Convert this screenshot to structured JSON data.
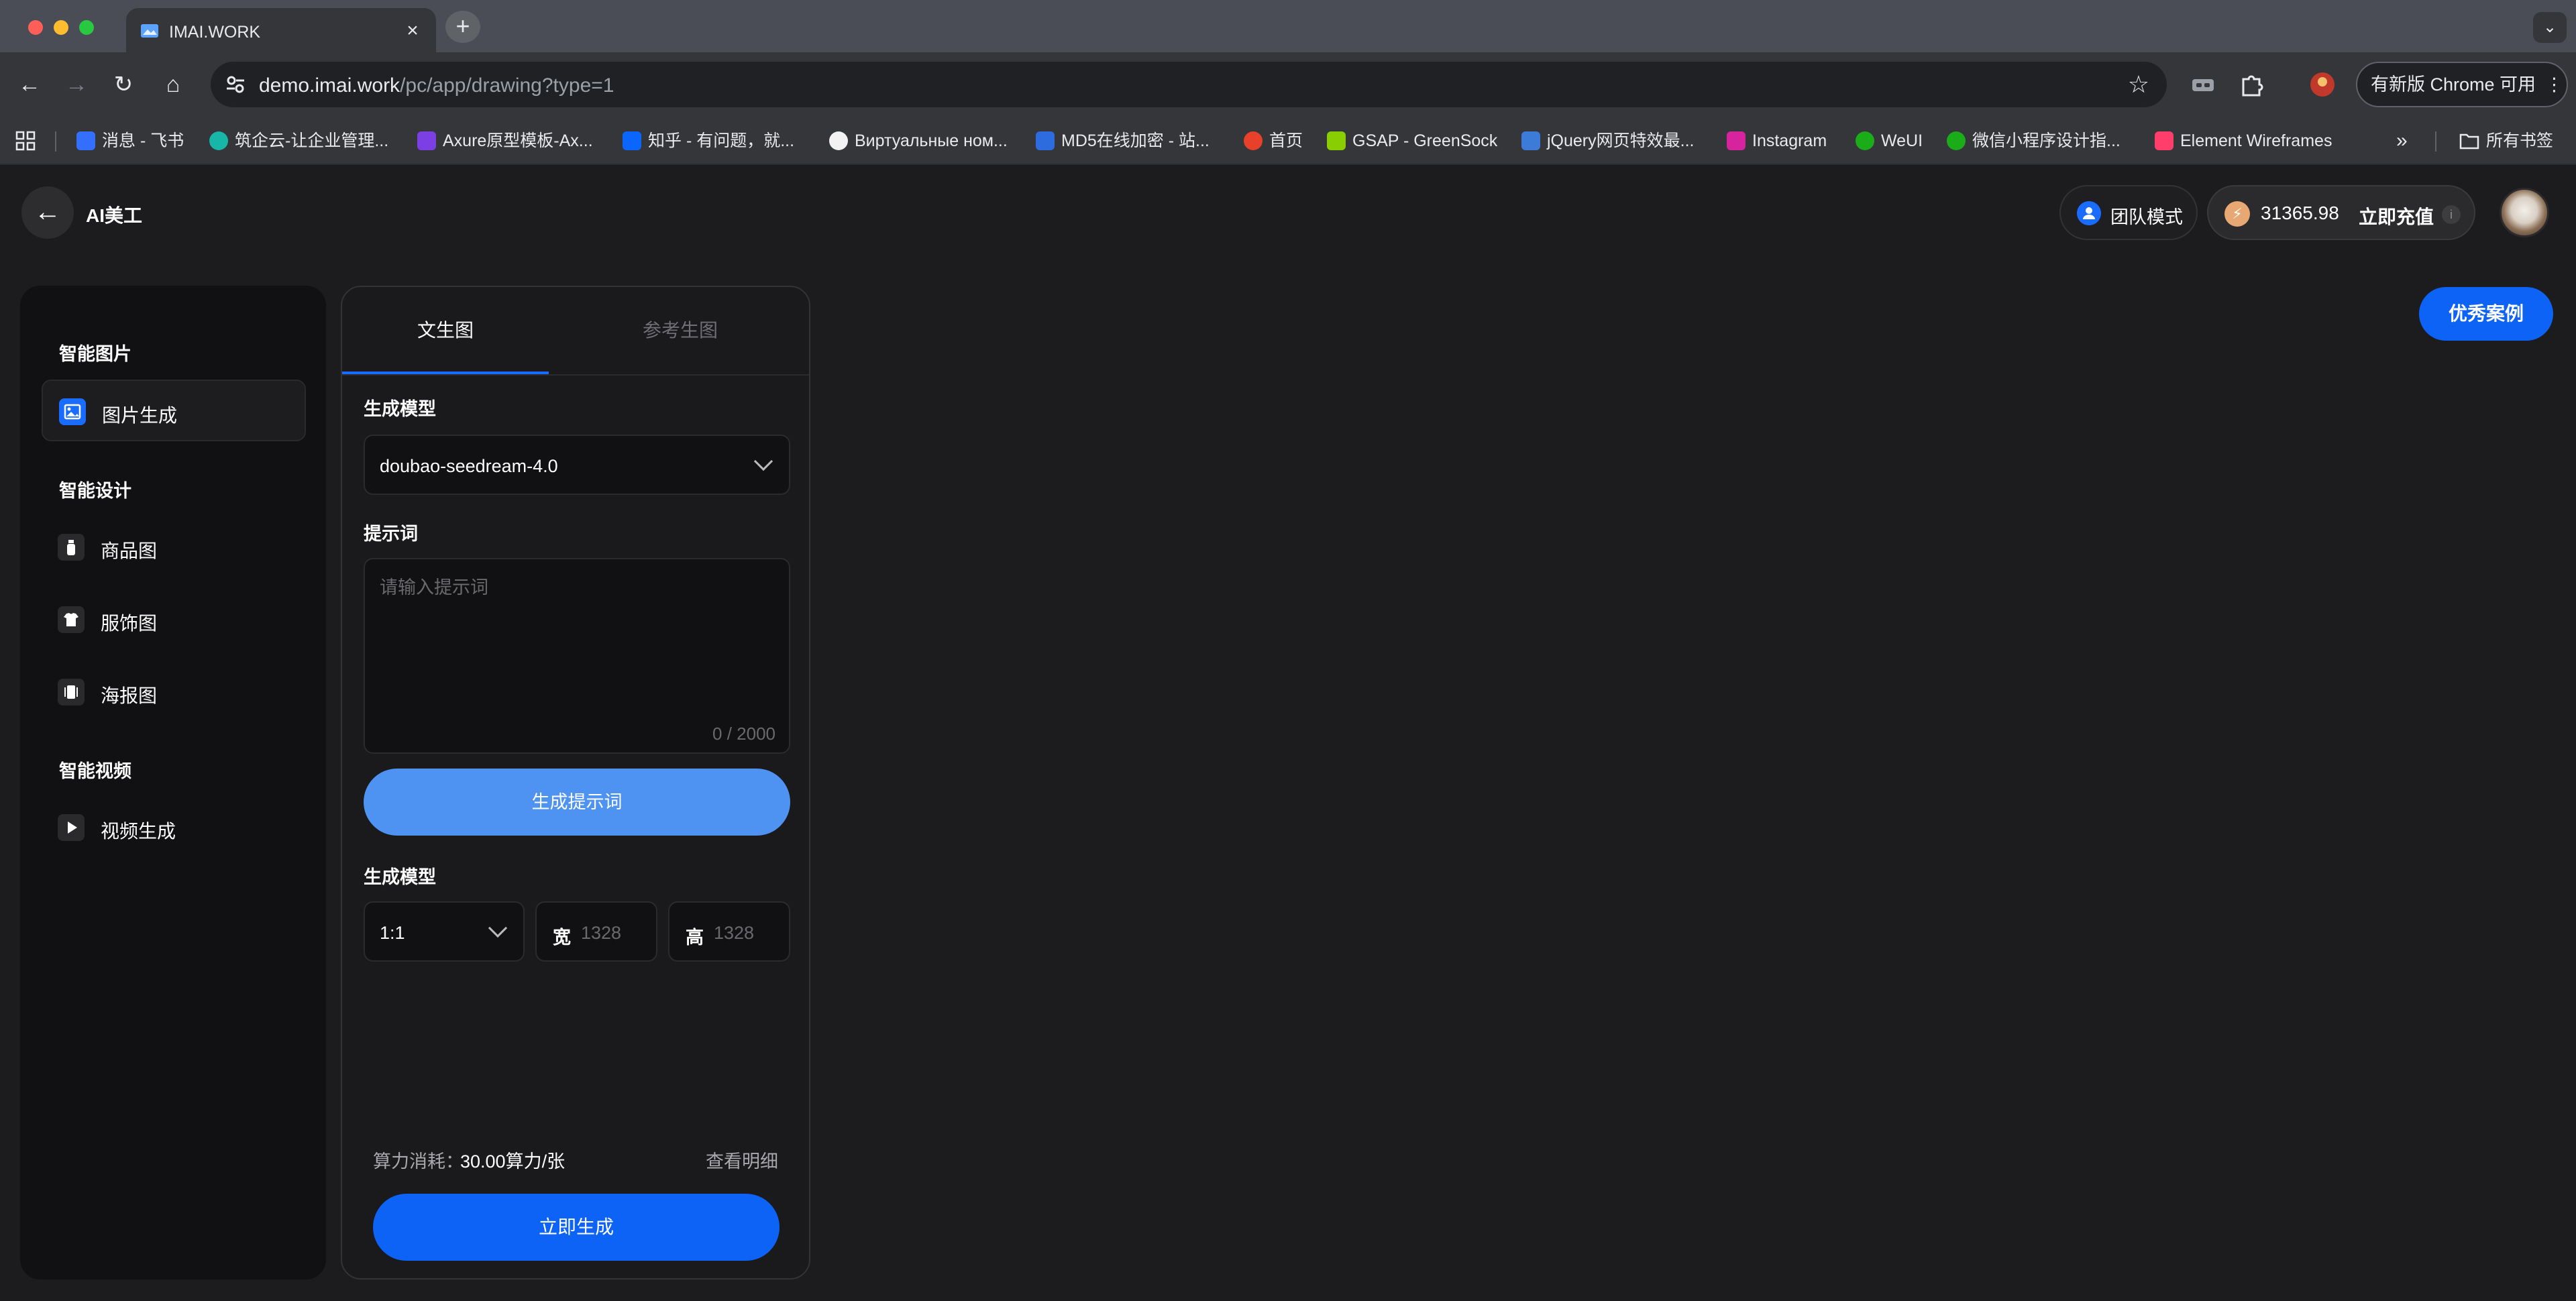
{
  "browser": {
    "tab_title": "IMAI.WORK",
    "url_host": "demo.imai.work",
    "url_path": "/pc/app/drawing?type=1",
    "update_label": "有新版 Chrome 可用",
    "bookmarks": [
      {
        "label": "消息 - 飞书",
        "color": "#3370ff"
      },
      {
        "label": "筑企云-让企业管理...",
        "color": "#17b6a8"
      },
      {
        "label": "Axure原型模板-Ax...",
        "color": "#7b3fe4"
      },
      {
        "label": "知乎 - 有问题，就...",
        "color": "#0a66ff"
      },
      {
        "label": "Виртуальные ном...",
        "color": "#f2f2f2"
      },
      {
        "label": "MD5在线加密 - 站...",
        "color": "#2d6cdf"
      },
      {
        "label": "首页",
        "color": "#e8412b"
      },
      {
        "label": "GSAP - GreenSock",
        "color": "#88ce02"
      },
      {
        "label": "jQuery网页特效最...",
        "color": "#3d7bd9"
      },
      {
        "label": "Instagram",
        "color": "#d6249f"
      },
      {
        "label": "WeUI",
        "color": "#1aad19"
      },
      {
        "label": "微信小程序设计指...",
        "color": "#1aad19"
      },
      {
        "label": "Element Wireframes",
        "color": "#ff3e6c"
      }
    ],
    "all_bookmarks": "所有书签"
  },
  "header": {
    "title": "AI美工",
    "team_mode": "团队模式",
    "credits": "31365.98",
    "recharge": "立即充值",
    "info": "i",
    "cases_button": "优秀案例"
  },
  "sidebar": {
    "sections": [
      {
        "title": "智能图片",
        "items": [
          {
            "label": "图片生成",
            "icon": "image-icon",
            "active": true
          }
        ]
      },
      {
        "title": "智能设计",
        "items": [
          {
            "label": "商品图",
            "icon": "bottle-icon",
            "active": false
          },
          {
            "label": "服饰图",
            "icon": "shirt-icon",
            "active": false
          },
          {
            "label": "海报图",
            "icon": "poster-icon",
            "active": false
          }
        ]
      },
      {
        "title": "智能视频",
        "items": [
          {
            "label": "视频生成",
            "icon": "play-icon",
            "active": false
          }
        ]
      }
    ]
  },
  "panel": {
    "tabs": [
      "文生图",
      "参考生图"
    ],
    "model_label": "生成模型",
    "model_value": "doubao-seedream-4.0",
    "prompt_label": "提示词",
    "prompt_placeholder": "请输入提示词",
    "prompt_count": "0 / 2000",
    "generate_prompt_button": "生成提示词",
    "size_label": "生成模型",
    "ratio_value": "1:1",
    "width_label": "宽",
    "width_value": "1328",
    "height_label": "高",
    "height_value": "1328",
    "cost_label": "算力消耗：",
    "cost_value": "30.00算力/张",
    "cost_detail": "查看明细",
    "generate_button": "立即生成"
  },
  "colors": {
    "accent": "#0d63f6",
    "prompt_button": "#4f93f2",
    "background": "#1c1c1e"
  }
}
